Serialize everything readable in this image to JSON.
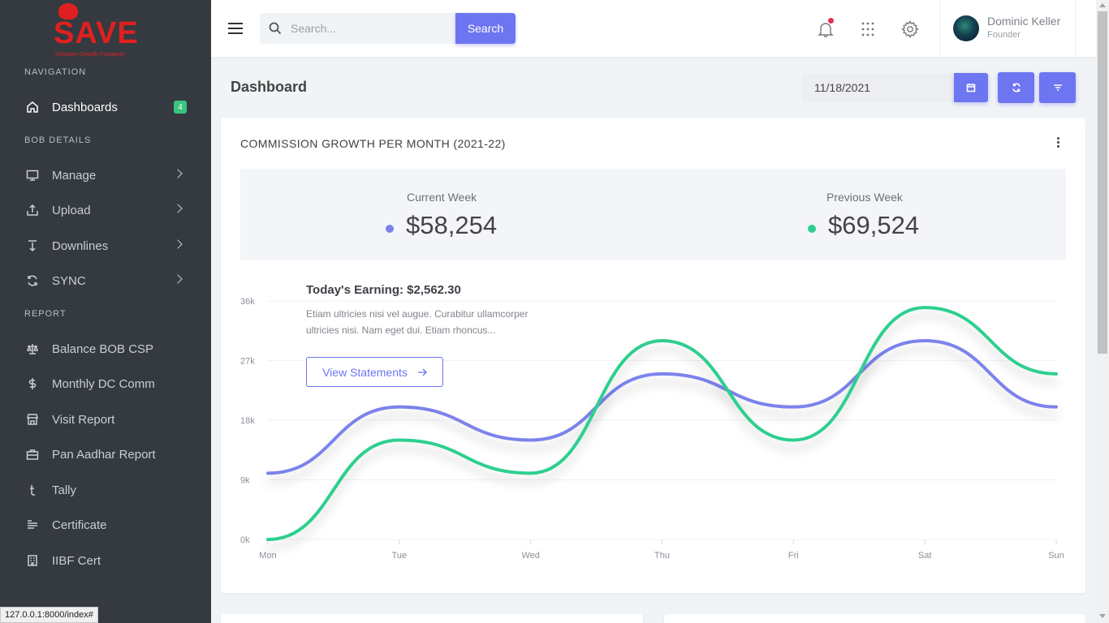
{
  "sidebar": {
    "sections": {
      "navigation": "NAVIGATION",
      "bob_details": "BOB DETAILS",
      "report": "REPORT"
    },
    "logo": {
      "text": "SAVE",
      "tagline": "Inclusion-Growth-Prosperity"
    },
    "dashboards": {
      "label": "Dashboards",
      "badge": "4"
    },
    "items": {
      "manage": "Manage",
      "upload": "Upload",
      "downlines": "Downlines",
      "sync": "SYNC",
      "balance": "Balance BOB CSP",
      "monthly": "Monthly DC Comm",
      "visit": "Visit Report",
      "pan": "Pan Aadhar Report",
      "tally": "Tally",
      "certificate": "Certificate",
      "iibf": "IIBF Cert"
    }
  },
  "status_bar": {
    "url": "127.0.0.1:8000/index#"
  },
  "header": {
    "search_placeholder": "Search...",
    "search_button": "Search",
    "user_name": "Dominic Keller",
    "user_role": "Founder"
  },
  "page": {
    "title": "Dashboard",
    "date": "11/18/2021"
  },
  "card": {
    "title": "COMMISSION GROWTH PER MONTH (2021-22)",
    "current_label": "Current Week",
    "current_value": "$58,254",
    "previous_label": "Previous Week",
    "previous_value": "$69,524",
    "earning_title": "Today's Earning: $2,562.30",
    "earning_desc": "Etiam ultricies nisi vel augue. Curabitur ullamcorper ultricies nisi. Nam eget dui. Etiam rhoncus...",
    "view_button": "View Statements"
  },
  "colors": {
    "accent": "#6d75f1",
    "series_current": "#7b83eb",
    "series_previous": "#2fcf8f",
    "sidebar_bg": "#343a40",
    "badge_green": "#3ac47d"
  },
  "chart_data": {
    "type": "line",
    "categories": [
      "Mon",
      "Tue",
      "Wed",
      "Thu",
      "Fri",
      "Sat",
      "Sun"
    ],
    "y_ticks": [
      "0k",
      "9k",
      "18k",
      "27k",
      "36k"
    ],
    "ylim": [
      0,
      36000
    ],
    "series": [
      {
        "values": [
          10000,
          20000,
          15000,
          25000,
          20000,
          30000,
          20000
        ],
        "color": "#7b83eb"
      },
      {
        "values": [
          0,
          15000,
          10000,
          30000,
          15000,
          35000,
          25000
        ],
        "color": "#2fcf8f"
      }
    ],
    "smooth": true,
    "grid": true
  }
}
